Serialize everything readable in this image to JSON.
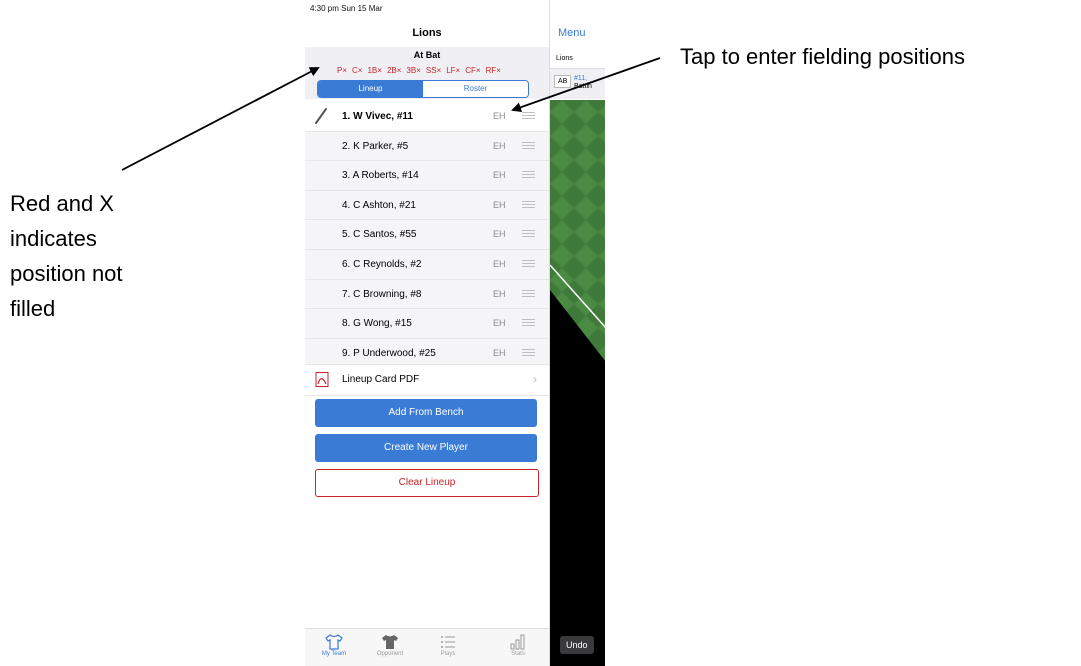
{
  "status_bar": {
    "time_date": "4:30 pm  Sun 15 Mar"
  },
  "nav": {
    "title": "Lions"
  },
  "at_bat": {
    "title": "At Bat",
    "positions": [
      "P×",
      "C×",
      "1B×",
      "2B×",
      "3B×",
      "SS×",
      "LF×",
      "CF×",
      "RF×"
    ]
  },
  "segment": {
    "lineup": "Lineup",
    "roster": "Roster",
    "selected": "Lineup"
  },
  "lineup": [
    {
      "name": "1. W Vivec, #11",
      "position": "EH"
    },
    {
      "name": "2. K Parker, #5",
      "position": "EH"
    },
    {
      "name": "3. A Roberts, #14",
      "position": "EH"
    },
    {
      "name": "4. C Ashton, #21",
      "position": "EH"
    },
    {
      "name": "5. C Santos, #55",
      "position": "EH"
    },
    {
      "name": "6. C Reynolds, #2",
      "position": "EH"
    },
    {
      "name": "7. C Browning, #8",
      "position": "EH"
    },
    {
      "name": "8. G Wong, #15",
      "position": "EH"
    },
    {
      "name": "9. P Underwood, #25",
      "position": "EH"
    }
  ],
  "pdf": {
    "label": "Lineup Card PDF",
    "chevron": "›"
  },
  "buttons": {
    "add_from_bench": "Add From Bench",
    "create_new_player": "Create New Player",
    "clear_lineup": "Clear Lineup"
  },
  "tabbar": {
    "my_team": "My Team",
    "opponent": "Opponent",
    "plays": "Plays",
    "stats": "Stats",
    "active": "My Team"
  },
  "side_panel": {
    "menu": "Menu",
    "team": "Lions",
    "ab": "AB",
    "batter_num": "#11, ",
    "batter_status": "Battin",
    "undo": "Undo"
  },
  "annotations": {
    "left_lines": [
      "Red and X",
      "indicates",
      "position not",
      "filled"
    ],
    "right": "Tap to enter fielding positions"
  },
  "colors": {
    "accent": "#3a7bd5",
    "unfilled": "#c8242b",
    "field_green": "#3f7a3a"
  }
}
